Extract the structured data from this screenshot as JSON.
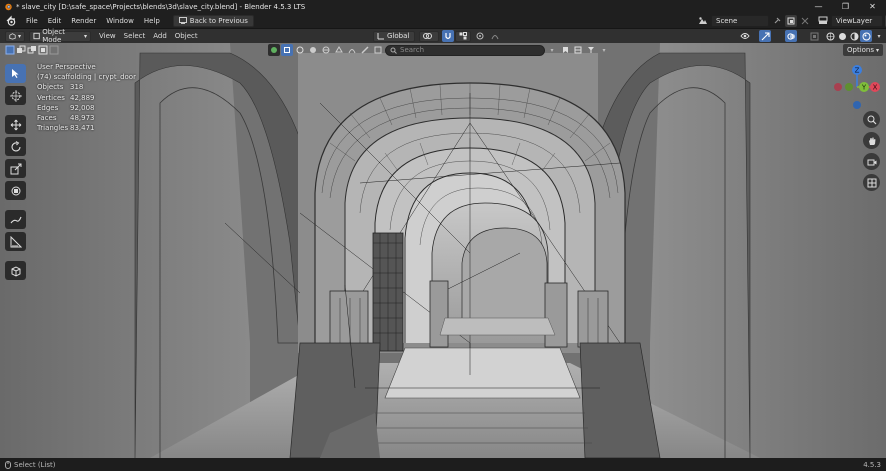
{
  "window": {
    "title": "* slave_city [D:\\safe_space\\Projects\\blends\\3d\\slave_city.blend] - Blender 4.5.3 LTS",
    "controls": [
      "—",
      "❐",
      "✕"
    ]
  },
  "menu": {
    "items": [
      "File",
      "Edit",
      "Render",
      "Window",
      "Help"
    ],
    "back_button": "Back to Previous",
    "scene_label": "Scene",
    "viewlayer_label": "ViewLayer"
  },
  "header": {
    "mode": "Object Mode",
    "menus": [
      "View",
      "Select",
      "Add",
      "Object"
    ],
    "transform_orientation": "Global"
  },
  "viewport_header": {
    "search_placeholder": "Search",
    "options_label": "Options"
  },
  "overlay": {
    "view_name": "User Perspective",
    "collection": "(74) scaffolding | crypt_door",
    "stats": [
      {
        "label": "Objects",
        "value": "318"
      },
      {
        "label": "Vertices",
        "value": "42,889"
      },
      {
        "label": "Edges",
        "value": "92,008"
      },
      {
        "label": "Faces",
        "value": "48,973"
      },
      {
        "label": "Triangles",
        "value": "83,471"
      }
    ]
  },
  "gizmo": {
    "axes": [
      "Z",
      "Y",
      "X"
    ]
  },
  "status": {
    "left": "Select (List)",
    "right": "4.5.3"
  },
  "colors": {
    "active_tool": "#4772b3",
    "axis_x": "#e0485a",
    "axis_y": "#7fbf3a",
    "axis_z": "#3b7fe0"
  }
}
